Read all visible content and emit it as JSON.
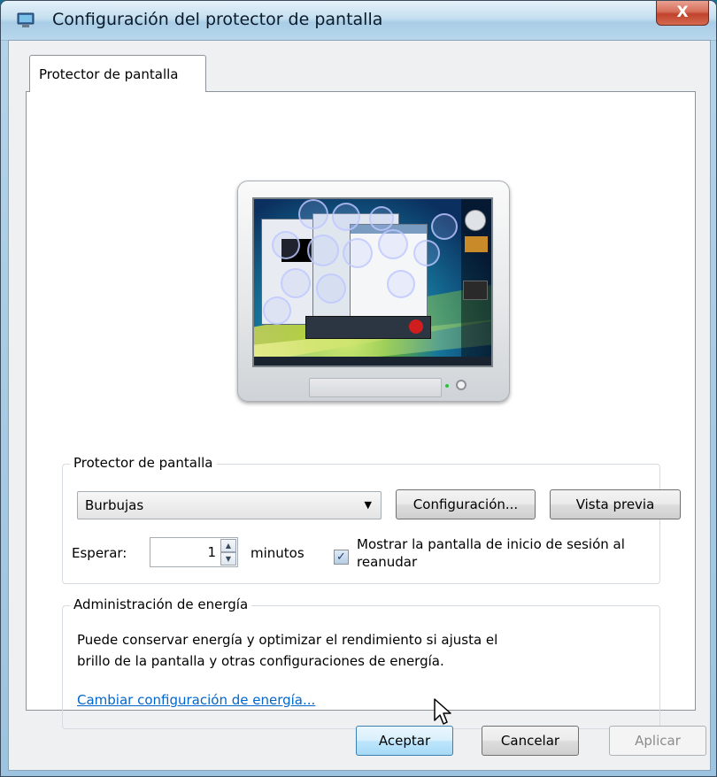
{
  "window": {
    "title": "Configuración del protector de pantalla",
    "close_label": "X"
  },
  "tab": {
    "label": "Protector de pantalla"
  },
  "screensaver_group": {
    "legend": "Protector de pantalla",
    "selected": "Burbujas",
    "settings_button": "Configuración...",
    "preview_button": "Vista previa",
    "wait_label": "Esperar:",
    "wait_value": "1",
    "minutes_label": "minutos",
    "resume_checkbox_checked": true,
    "resume_label_line1": "Mostrar la pantalla de inicio de sesión al",
    "resume_label_line2": "reanudar"
  },
  "power_group": {
    "legend": "Administración de energía",
    "description_line1": "Puede conservar energía y optimizar el rendimiento si ajusta el",
    "description_line2": "brillo de la pantalla y otras configuraciones de energía.",
    "link": "Cambiar configuración de energía..."
  },
  "footer": {
    "ok": "Aceptar",
    "cancel": "Cancelar",
    "apply": "Aplicar"
  },
  "icons": {
    "app": "display-settings-icon",
    "dropdown": "chevron-down-icon",
    "spin_up": "spin-up-icon",
    "spin_down": "spin-down-icon",
    "check": "checkmark-icon",
    "cursor": "mouse-cursor-icon"
  },
  "colors": {
    "link": "#0066cc",
    "close_button": "#c1432c",
    "default_button_border": "#3c7fb1"
  }
}
